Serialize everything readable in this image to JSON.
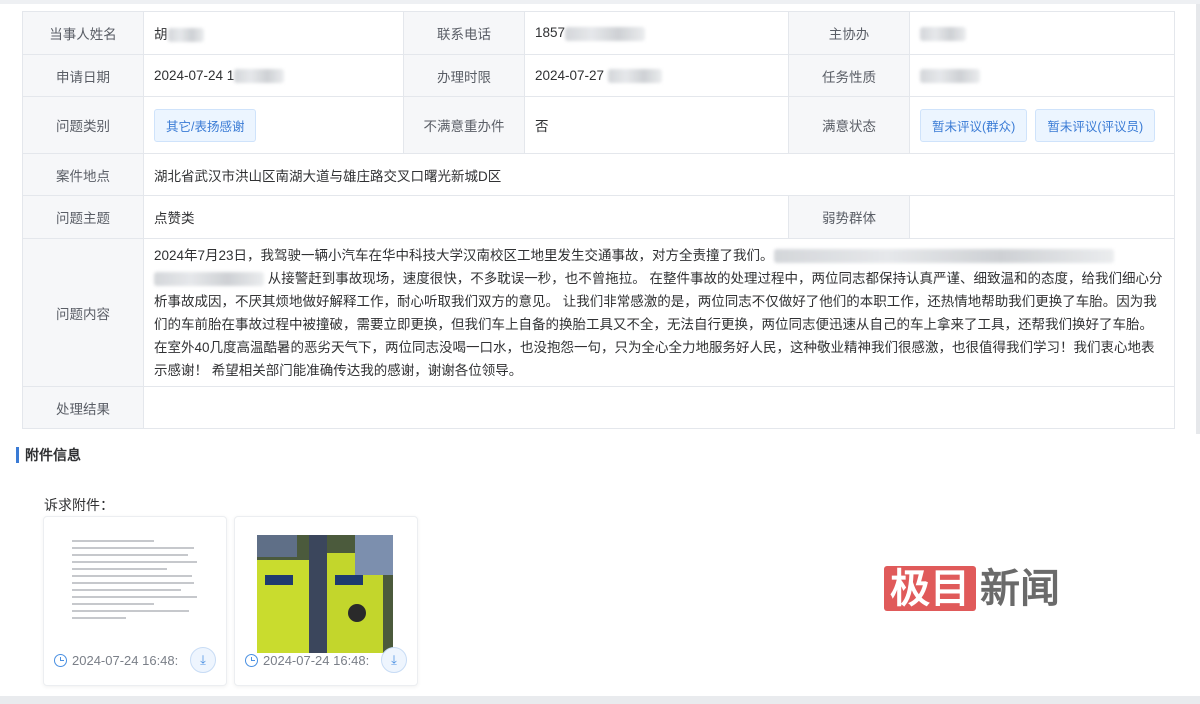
{
  "row1": {
    "label1": "当事人姓名",
    "value1": "胡",
    "label2": "联系电话",
    "value2": "1857",
    "label3": "主协办"
  },
  "row2": {
    "label1": "申请日期",
    "value1": "2024-07-24 1",
    "label2": "办理时限",
    "value2": "2024-07-27",
    "label3": "任务性质"
  },
  "row3": {
    "label1": "问题类别",
    "tag": "其它/表扬感谢",
    "label2": "不满意重办件",
    "value2": "否",
    "label3": "满意状态",
    "tag_public": "暂未评议(群众)",
    "tag_reviewer": "暂未评议(评议员)"
  },
  "row4": {
    "label": "案件地点",
    "value": "湖北省武汉市洪山区南湖大道与雄庄路交叉口曙光新城D区"
  },
  "row5": {
    "label": "问题主题",
    "value": "点赞类",
    "label2": "弱势群体"
  },
  "row6": {
    "label": "问题内容",
    "p1": "2024年7月23日，我驾驶一辆小汽车在华中科技大学汉南校区工地里发生交通事故，对方全责撞了我们。",
    "p2": "从接警赶到事故现场，速度很快，不多耽误一秒，也不曾拖拉。 在整件事故的处理过程中，两位同志都保持认真严谨、细致温和的态度，给我们细心分析事故成因，不厌其烦地做好解释工作，耐心听取我们双方的意见。 让我们非常感激的是，两位同志不仅做好了他们的本职工作，还热情地帮助我们更换了车胎。因为我们的车前胎在事故过程中被撞破，需要立即更换，但我们车上自备的换胎工具又不全，无法自行更换，两位同志便迅速从自己的车上拿来了工具，还帮我们换好了车胎。 在室外40几度高温酷暑的恶劣天气下，两位同志没喝一口水，也没抱怨一句，只为全心全力地服务好人民，这种敬业精神我们很感激，也很值得我们学习！我们衷心地表示感谢！ 希望相关部门能准确传达我的感谢，谢谢各位领导。"
  },
  "row7": {
    "label": "处理结果"
  },
  "attachments": {
    "section_title": "附件信息",
    "label": "诉求附件：",
    "files": [
      {
        "date": "2024-07-24 16:48:"
      },
      {
        "date": "2024-07-24 16:48:"
      }
    ]
  },
  "watermark": {
    "part1": "极目",
    "part2": "新闻"
  }
}
